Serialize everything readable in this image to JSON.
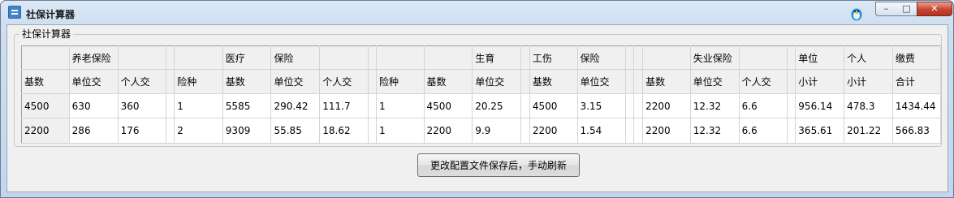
{
  "window": {
    "title": "社保计算器",
    "controls": {
      "minimize": "–",
      "maximize": "□",
      "close": "✕"
    }
  },
  "group": {
    "label": "社保计算器"
  },
  "table": {
    "header_row_1": [
      "",
      "养老保险",
      "",
      "",
      "",
      "医疗",
      "保险",
      "",
      "",
      "",
      "",
      "生育",
      "",
      "工伤",
      "保险",
      "",
      "",
      "",
      "失业保险",
      "",
      "",
      "单位",
      "个人",
      "缴费"
    ],
    "header_row_2": [
      "基数",
      "单位交",
      "个人交",
      "",
      "险种",
      "基数",
      "单位交",
      "个人交",
      "",
      "险种",
      "基数",
      "单位交",
      "",
      "基数",
      "单位交",
      "",
      "",
      "基数",
      "单位交",
      "个人交",
      "",
      "小计",
      "小计",
      "合计"
    ],
    "rows": [
      [
        "4500",
        "630",
        "360",
        "",
        "1",
        "5585",
        "290.42",
        "111.7",
        "",
        "1",
        "4500",
        "20.25",
        "",
        "4500",
        "3.15",
        "",
        "",
        "2200",
        "12.32",
        "6.6",
        "",
        "956.14",
        "478.3",
        "1434.44"
      ],
      [
        "2200",
        "286",
        "176",
        "",
        "2",
        "9309",
        "55.85",
        "18.62",
        "",
        "1",
        "2200",
        "9.9",
        "",
        "2200",
        "1.54",
        "",
        "",
        "2200",
        "12.32",
        "6.6",
        "",
        "365.61",
        "201.22",
        "566.83"
      ]
    ]
  },
  "refresh_button": {
    "label": "更改配置文件保存后，手动刷新"
  },
  "icons": {
    "app": "calculator-app-icon",
    "tray": "qq-penguin-icon"
  }
}
